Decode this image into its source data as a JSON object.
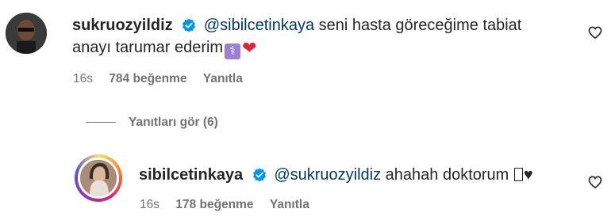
{
  "comment": {
    "username": "sukruozyildiz",
    "mention": "@sibilcetinkaya",
    "text_line1": "seni hasta göreceğime tabiat",
    "text_line2": "anayı tarumar ederim",
    "emoji_medical": "⚕",
    "emoji_heart": "❤",
    "time": "16s",
    "likes": "784 beğenme",
    "reply_label": "Yanıtla"
  },
  "view_replies": {
    "label": "Yanıtları gör (6)"
  },
  "reply": {
    "username": "sibilcetinkaya",
    "mention": "@sukruozyildiz",
    "text": "ahahah doktorum",
    "trailing_heart": "♥",
    "time": "16s",
    "likes": "178 beğenme",
    "reply_label": "Yanıtla"
  },
  "colors": {
    "verified_blue": "#0095f6",
    "mention": "#00376b",
    "meta_gray": "#737373"
  },
  "icons": {
    "verified": "verified-badge-icon",
    "like": "heart-outline-icon"
  }
}
